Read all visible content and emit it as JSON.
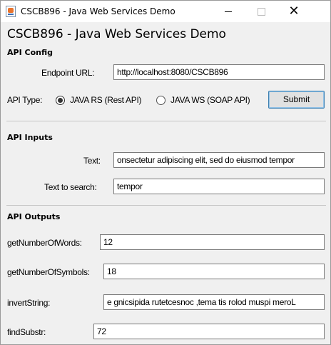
{
  "window": {
    "title": "CSCB896 - Java Web Services Demo",
    "controls": {
      "minimize": "—",
      "maximize": "□",
      "close": "✕"
    }
  },
  "heading": "CSCB896 - Java Web Services Demo",
  "config": {
    "section_label": "API Config",
    "endpoint_label": "Endpoint URL:",
    "endpoint_value": "http://localhost:8080/CSCB896",
    "api_type_label": "API Type:",
    "options": [
      {
        "label": "JAVA RS (Rest API)",
        "selected": true
      },
      {
        "label": "JAVA WS (SOAP API)",
        "selected": false
      }
    ],
    "submit_label": "Submit"
  },
  "inputs": {
    "section_label": "API Inputs",
    "text_label": "Text:",
    "text_value": "onsectetur adipiscing elit, sed do eiusmod tempor",
    "search_label": "Text to search:",
    "search_value": "tempor"
  },
  "outputs": {
    "section_label": "API Outputs",
    "rows": [
      {
        "label": "getNumberOfWords:",
        "value": "12"
      },
      {
        "label": "getNumberOfSymbols:",
        "value": "18"
      },
      {
        "label": "invertString:",
        "value": "e gnicsipida rutetcesnoc ,tema tis rolod muspi meroL"
      },
      {
        "label": "findSubstr:",
        "value": "72"
      }
    ]
  }
}
